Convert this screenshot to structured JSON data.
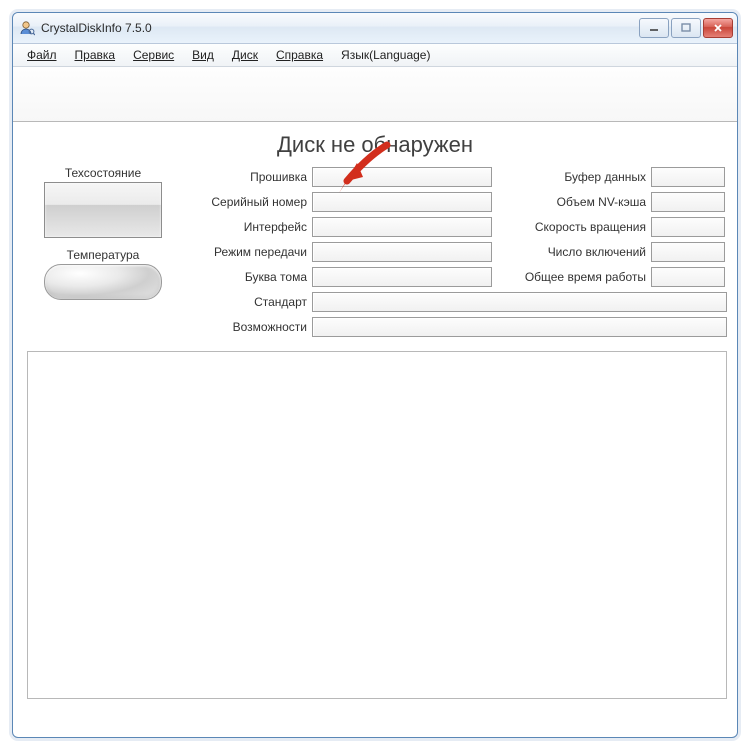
{
  "window": {
    "title": "CrystalDiskInfo 7.5.0"
  },
  "menu": {
    "file": "Файл",
    "edit": "Правка",
    "service": "Сервис",
    "view": "Вид",
    "disk": "Диск",
    "help": "Справка",
    "language": "Язык(Language)"
  },
  "title_message": "Диск не обнаружен",
  "side": {
    "health_label": "Техсостояние",
    "temp_label": "Температура"
  },
  "labels": {
    "firmware": "Прошивка",
    "serial": "Серийный номер",
    "interface": "Интерфейс",
    "transfer": "Режим передачи",
    "drive_letter": "Буква тома",
    "standard": "Стандарт",
    "features": "Возможности",
    "buffer": "Буфер данных",
    "nv_cache": "Объем NV-кэша",
    "rotation": "Скорость вращения",
    "power_on_count": "Число включений",
    "power_on_hours": "Общее время работы"
  },
  "values": {
    "firmware": "",
    "serial": "",
    "interface": "",
    "transfer": "",
    "drive_letter": "",
    "standard": "",
    "features": "",
    "buffer": "",
    "nv_cache": "",
    "rotation": "",
    "power_on_count": "",
    "power_on_hours": ""
  },
  "annotation": {
    "color": "#d22e1c"
  }
}
